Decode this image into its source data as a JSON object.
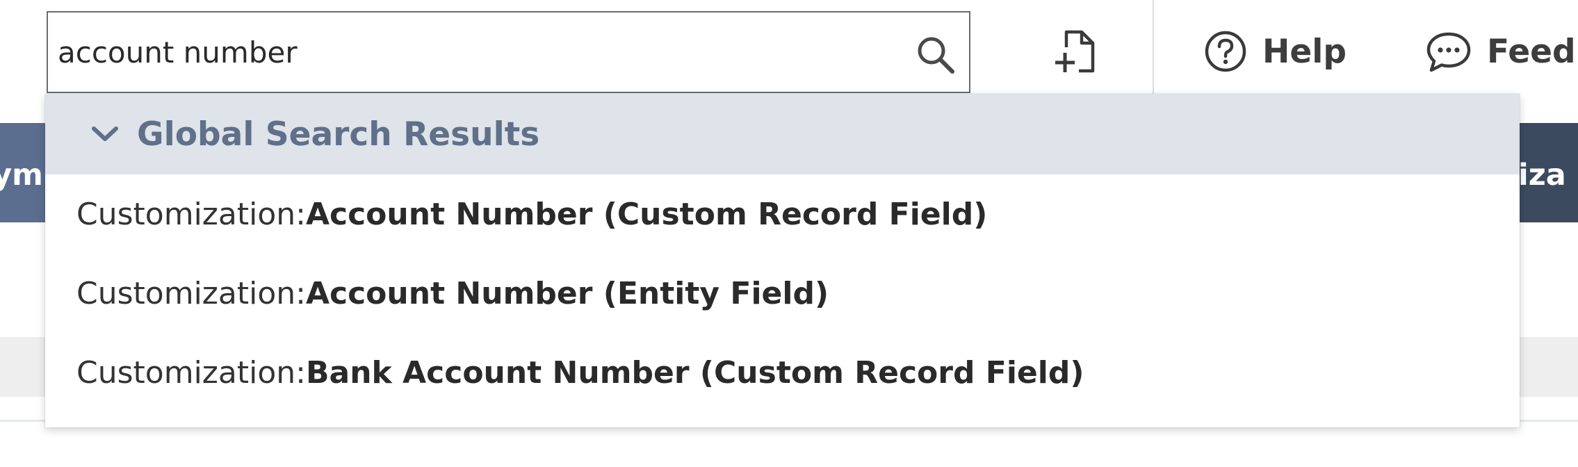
{
  "search": {
    "value": "account number",
    "placeholder": ""
  },
  "toolbar": {
    "help_label": "Help",
    "feedback_label": "Feedl"
  },
  "background": {
    "left_nav_text": "ym",
    "right_nav_text": "iza"
  },
  "dropdown": {
    "header_label": "Global Search Results",
    "results": [
      {
        "prefix": "Customization: ",
        "title": "Account Number (Custom Record Field)"
      },
      {
        "prefix": "Customization: ",
        "title": "Account Number (Entity Field)"
      },
      {
        "prefix": "Customization: ",
        "title": "Bank Account Number (Custom Record Field)"
      }
    ]
  },
  "colors": {
    "header_bg": "#dfe3ea",
    "header_text": "#607089",
    "nav_left_bg": "#5b6e8f",
    "nav_right_bg": "#3c4a5f"
  },
  "icons": [
    "search-icon",
    "new-record-icon",
    "help-icon",
    "feedback-icon",
    "chevron-down-icon"
  ]
}
